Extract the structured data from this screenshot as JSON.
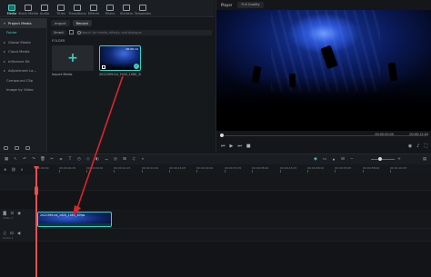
{
  "toolbar": {
    "items": [
      {
        "label": "Media",
        "icon": "media-icon",
        "active": true
      },
      {
        "label": "Stock Media",
        "icon": "stock-media-icon"
      },
      {
        "label": "Audio",
        "icon": "audio-icon"
      },
      {
        "label": "Titles",
        "icon": "titles-icon"
      },
      {
        "label": "Transitions",
        "icon": "transitions-icon"
      },
      {
        "label": "Effects",
        "icon": "effects-icon"
      },
      {
        "label": "Filters",
        "icon": "filters-icon"
      },
      {
        "label": "Stickers",
        "icon": "stickers-icon"
      },
      {
        "label": "Templates",
        "icon": "templates-icon"
      }
    ]
  },
  "sidebar": {
    "items": [
      {
        "label": "Project Media",
        "active": true
      },
      {
        "label": "Folder",
        "sub": true
      },
      {
        "label": "Global Media"
      },
      {
        "label": "Cloud Media"
      },
      {
        "label": "Influence Kit"
      },
      {
        "label": "Adjustment La..."
      },
      {
        "label": "Compound Clip"
      },
      {
        "label": "Image by Video"
      }
    ]
  },
  "media": {
    "import_tab": "Import",
    "record_tab": "Record",
    "sort_label": "Smart",
    "search_placeholder": "Search for media, effects, and dialogue",
    "folder_label": "FOLDER",
    "import_label": "Import Media",
    "clip": {
      "name": "2022399-hd_1920_1080_30fps",
      "duration": "00:00:12"
    }
  },
  "player": {
    "title": "Player",
    "quality": "Full Quality",
    "time_current": "00:00:00:00",
    "time_total": "00:00:12:04"
  },
  "ruler": {
    "ticks": [
      "00:00:00",
      "00:00:04:25",
      "00:00:09:20",
      "00:00:14:15",
      "00:00:19:10",
      "00:00:24:05",
      "00:00:29:00",
      "00:00:33:25",
      "00:00:38:20",
      "00:00:43:15",
      "00:00:48:10",
      "00:00:53:05",
      "00:00:58:00",
      "00:01:02:25",
      "00:01:07:20"
    ]
  },
  "tracks": {
    "video_label": "Video 1",
    "audio_label": "Audio 1"
  },
  "timeline_clip": {
    "name": "2022399-hd_1920_1080_30fps"
  },
  "colors": {
    "accent": "#3fd0c1",
    "playhead": "#e65050",
    "annotation": "#d9262b"
  }
}
